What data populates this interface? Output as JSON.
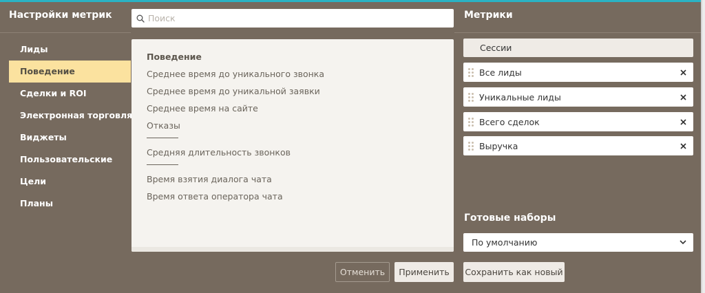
{
  "sidebar": {
    "title": "Настройки метрик",
    "items": [
      {
        "label": "Лиды",
        "active": false
      },
      {
        "label": "Поведение",
        "active": true
      },
      {
        "label": "Сделки и ROI",
        "active": false
      },
      {
        "label": "Электронная торговля",
        "active": false
      },
      {
        "label": "Виджеты",
        "active": false
      },
      {
        "label": "Пользовательские",
        "active": false
      },
      {
        "label": "Цели",
        "active": false
      },
      {
        "label": "Планы",
        "active": false
      }
    ]
  },
  "search": {
    "placeholder": "Поиск",
    "value": "",
    "icon": "search-icon"
  },
  "metric_list": {
    "heading": "Поведение",
    "groups": [
      [
        "Среднее время до уникального звонка",
        "Среднее время до уникальной заявки",
        "Среднее время на сайте",
        "Отказы"
      ],
      [
        "Средняя длительность звонков"
      ],
      [
        "Время взятия диалога чата",
        "Время ответа оператора чата"
      ]
    ]
  },
  "metrics": {
    "title": "Метрики",
    "fixed": "Сессии",
    "selected": [
      "Все лиды",
      "Уникальные лиды",
      "Всего сделок",
      "Выручка"
    ],
    "remove_icon": "close-icon",
    "drag_icon": "drag-handle-icon"
  },
  "presets": {
    "title": "Готовые наборы",
    "selected": "По умолчанию",
    "icon": "chevron-down-icon"
  },
  "buttons": {
    "cancel": "Отменить",
    "apply": "Применить",
    "save_new": "Сохранить как новый"
  },
  "colors": {
    "background": "#766a5e",
    "active_nav": "#fbe29f",
    "accent": "#2ab3c4",
    "panel": "#f5f3ef"
  }
}
